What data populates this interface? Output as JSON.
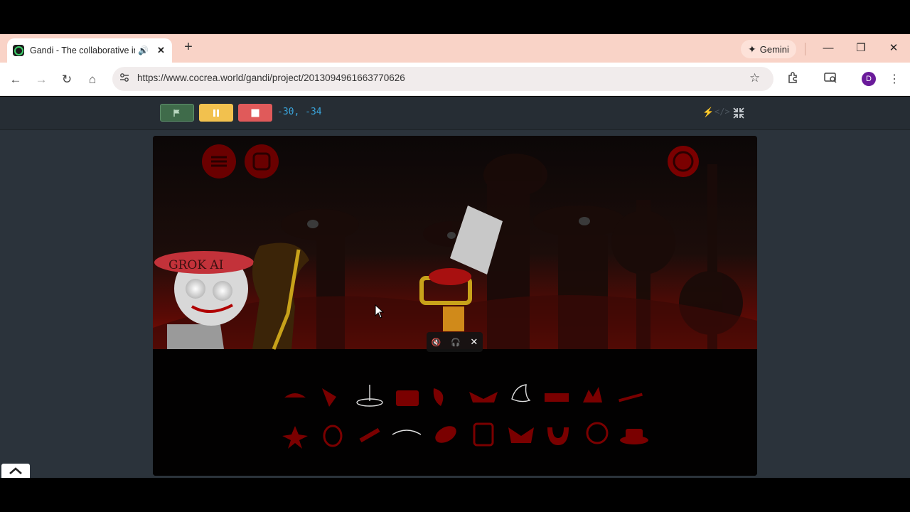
{
  "browser": {
    "tab": {
      "title": "Gandi - The collaborative in",
      "audio_icon": "🔊",
      "close_label": "✕"
    },
    "new_tab_label": "+",
    "gemini_label": "Gemini",
    "window": {
      "minimize": "—",
      "restore": "❐",
      "close": "✕"
    },
    "nav": {
      "back": "←",
      "forward": "→",
      "reload": "↻",
      "home": "⌂"
    },
    "url": "https://www.cocrea.world/gandi/project/2013094961663770626",
    "profile_initial": "D",
    "icons": [
      "site-info-icon",
      "bookmark-star-icon",
      "extensions-icon",
      "cast-icon",
      "kebab-menu-icon"
    ]
  },
  "project": {
    "coords": "-30,  -34",
    "controls": [
      "green-flag",
      "pause",
      "stop"
    ],
    "right_icons": [
      "turbo-icon",
      "code-icon",
      "shrink-icon"
    ]
  },
  "stage": {
    "character_label": "GROK AI",
    "media_controls": {
      "mute": "🔇",
      "headphones": "🎧",
      "close": "✕"
    },
    "colors": {
      "accent_red": "#b00000",
      "dark_red": "#5a0000",
      "background": "#020101"
    }
  }
}
